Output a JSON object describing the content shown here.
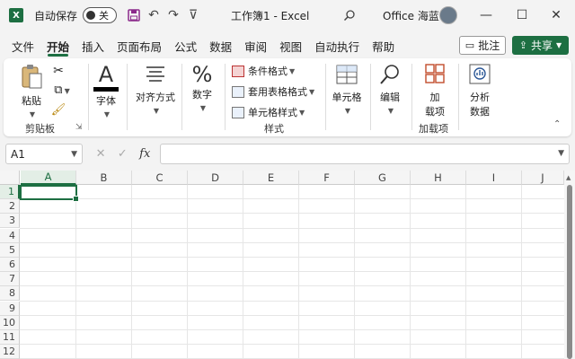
{
  "titlebar": {
    "logo_letter": "X",
    "autosave_label": "自动保存",
    "autosave_state": "关",
    "doc_title": "工作簿1 - Excel",
    "user_name": "Office 海蓝",
    "minimize": "—",
    "maximize": "☐",
    "close": "✕",
    "customize": "⊽",
    "undo": "↶",
    "redo": "↷"
  },
  "tabs": [
    {
      "label": "文件",
      "active": false
    },
    {
      "label": "开始",
      "active": true
    },
    {
      "label": "插入",
      "active": false
    },
    {
      "label": "页面布局",
      "active": false
    },
    {
      "label": "公式",
      "active": false
    },
    {
      "label": "数据",
      "active": false
    },
    {
      "label": "审阅",
      "active": false
    },
    {
      "label": "视图",
      "active": false
    },
    {
      "label": "自动执行",
      "active": false
    },
    {
      "label": "帮助",
      "active": false
    }
  ],
  "actions": {
    "comment": "批注",
    "share": "共享"
  },
  "ribbon": {
    "clipboard": {
      "paste": "粘贴",
      "group": "剪贴板"
    },
    "font": {
      "label": "字体",
      "glyph": "A"
    },
    "alignment": {
      "label": "对齐方式"
    },
    "number": {
      "label": "数字",
      "glyph": "%"
    },
    "styles": {
      "conditional": "条件格式",
      "table_format": "套用表格格式",
      "cell_styles": "单元格样式",
      "group": "样式"
    },
    "cells": {
      "label": "单元格"
    },
    "editing": {
      "label": "编辑"
    },
    "addins": {
      "label1": "加",
      "label2": "载项",
      "group": "加载项"
    },
    "analysis": {
      "label1": "分析",
      "label2": "数据"
    }
  },
  "formula_bar": {
    "name_box": "A1",
    "cancel": "✕",
    "enter": "✓",
    "fx": "fx",
    "value": ""
  },
  "grid": {
    "columns": [
      "A",
      "B",
      "C",
      "D",
      "E",
      "F",
      "G",
      "H",
      "I",
      "J"
    ],
    "rows": [
      "1",
      "2",
      "3",
      "4",
      "5",
      "6",
      "7",
      "8",
      "9",
      "10",
      "11",
      "12"
    ],
    "selected_cell": "A1"
  },
  "colors": {
    "accent": "#1d6f42",
    "save_icon": "#8b2a8b"
  }
}
